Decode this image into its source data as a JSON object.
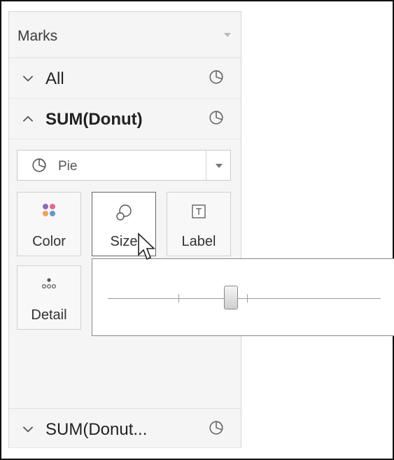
{
  "marks": {
    "title": "Marks",
    "cards": [
      {
        "label": "All",
        "state": "collapsed",
        "icon": "pie-chart-icon"
      },
      {
        "label": "SUM(Donut)",
        "state": "expanded",
        "icon": "pie-chart-icon"
      },
      {
        "label": "SUM(Donut...",
        "state": "collapsed",
        "icon": "pie-chart-icon"
      }
    ],
    "mark_type": {
      "value": "Pie",
      "icon": "pie-chart-icon"
    },
    "buttons": [
      {
        "label": "Color",
        "icon": "color-dots-icon"
      },
      {
        "label": "Size",
        "icon": "size-icon"
      },
      {
        "label": "Label",
        "icon": "text-label-icon"
      },
      {
        "label": "Detail",
        "icon": "detail-dots-icon"
      }
    ],
    "size_slider": {
      "value_fraction": 0.45
    }
  },
  "colors": {
    "dot_purple": "#8e6bb8",
    "dot_pink": "#e36a8a",
    "dot_orange": "#f4a15a",
    "dot_blue": "#5a9bd5"
  }
}
